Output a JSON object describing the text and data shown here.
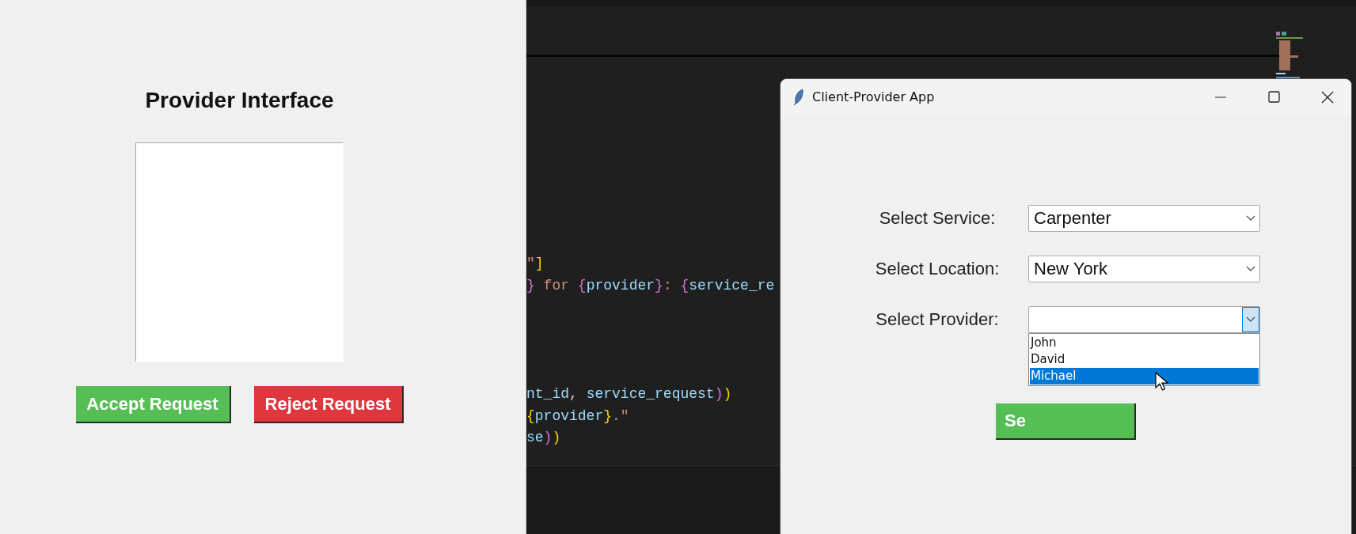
{
  "provider_panel": {
    "title": "Provider Interface",
    "buttons": [
      {
        "label": "Accept Request",
        "kind": "accept"
      },
      {
        "label": "Reject Request",
        "kind": "reject"
      }
    ]
  },
  "editor": {
    "code_blocks": [
      [
        {
          "tokens": [
            {
              "t": "\"",
              "kind": "string"
            },
            {
              "t": "]",
              "kind": "bracket1"
            }
          ]
        },
        {
          "tokens": [
            {
              "t": "}",
              "kind": "bracket2"
            },
            {
              "t": " for ",
              "kind": "string"
            },
            {
              "t": "{",
              "kind": "bracket2"
            },
            {
              "t": "provider",
              "kind": "variable"
            },
            {
              "t": "}",
              "kind": "bracket2"
            },
            {
              "t": ": ",
              "kind": "string"
            },
            {
              "t": "{",
              "kind": "bracket2"
            },
            {
              "t": "service_re",
              "kind": "variable"
            }
          ]
        }
      ],
      [
        {
          "tokens": [
            {
              "t": "nt_id",
              "kind": "variable"
            },
            {
              "t": ", ",
              "kind": "plain"
            },
            {
              "t": "service_request",
              "kind": "variable"
            },
            {
              "t": ")",
              "kind": "bracket2"
            },
            {
              "t": ")",
              "kind": "bracket1"
            }
          ]
        },
        {
          "tokens": [
            {
              "t": "{",
              "kind": "bracket1"
            },
            {
              "t": "provider",
              "kind": "variable"
            },
            {
              "t": "}",
              "kind": "bracket1"
            },
            {
              "t": ".\"",
              "kind": "string"
            }
          ]
        },
        {
          "tokens": [
            {
              "t": "se",
              "kind": "variable"
            },
            {
              "t": ")",
              "kind": "bracket2"
            },
            {
              "t": ")",
              "kind": "bracket1"
            }
          ]
        }
      ]
    ]
  },
  "client_window": {
    "title": "Client-Provider App",
    "fields": [
      {
        "label": "Select Service:",
        "value": "Carpenter",
        "open": false
      },
      {
        "label": "Select Location:",
        "value": "New York",
        "open": false
      },
      {
        "label": "Select Provider:",
        "open": true,
        "options": [
          {
            "label": "John",
            "selected": false
          },
          {
            "label": "David",
            "selected": false
          },
          {
            "label": "Michael",
            "selected": true
          }
        ]
      }
    ],
    "send_button": {
      "label": "Se"
    }
  }
}
